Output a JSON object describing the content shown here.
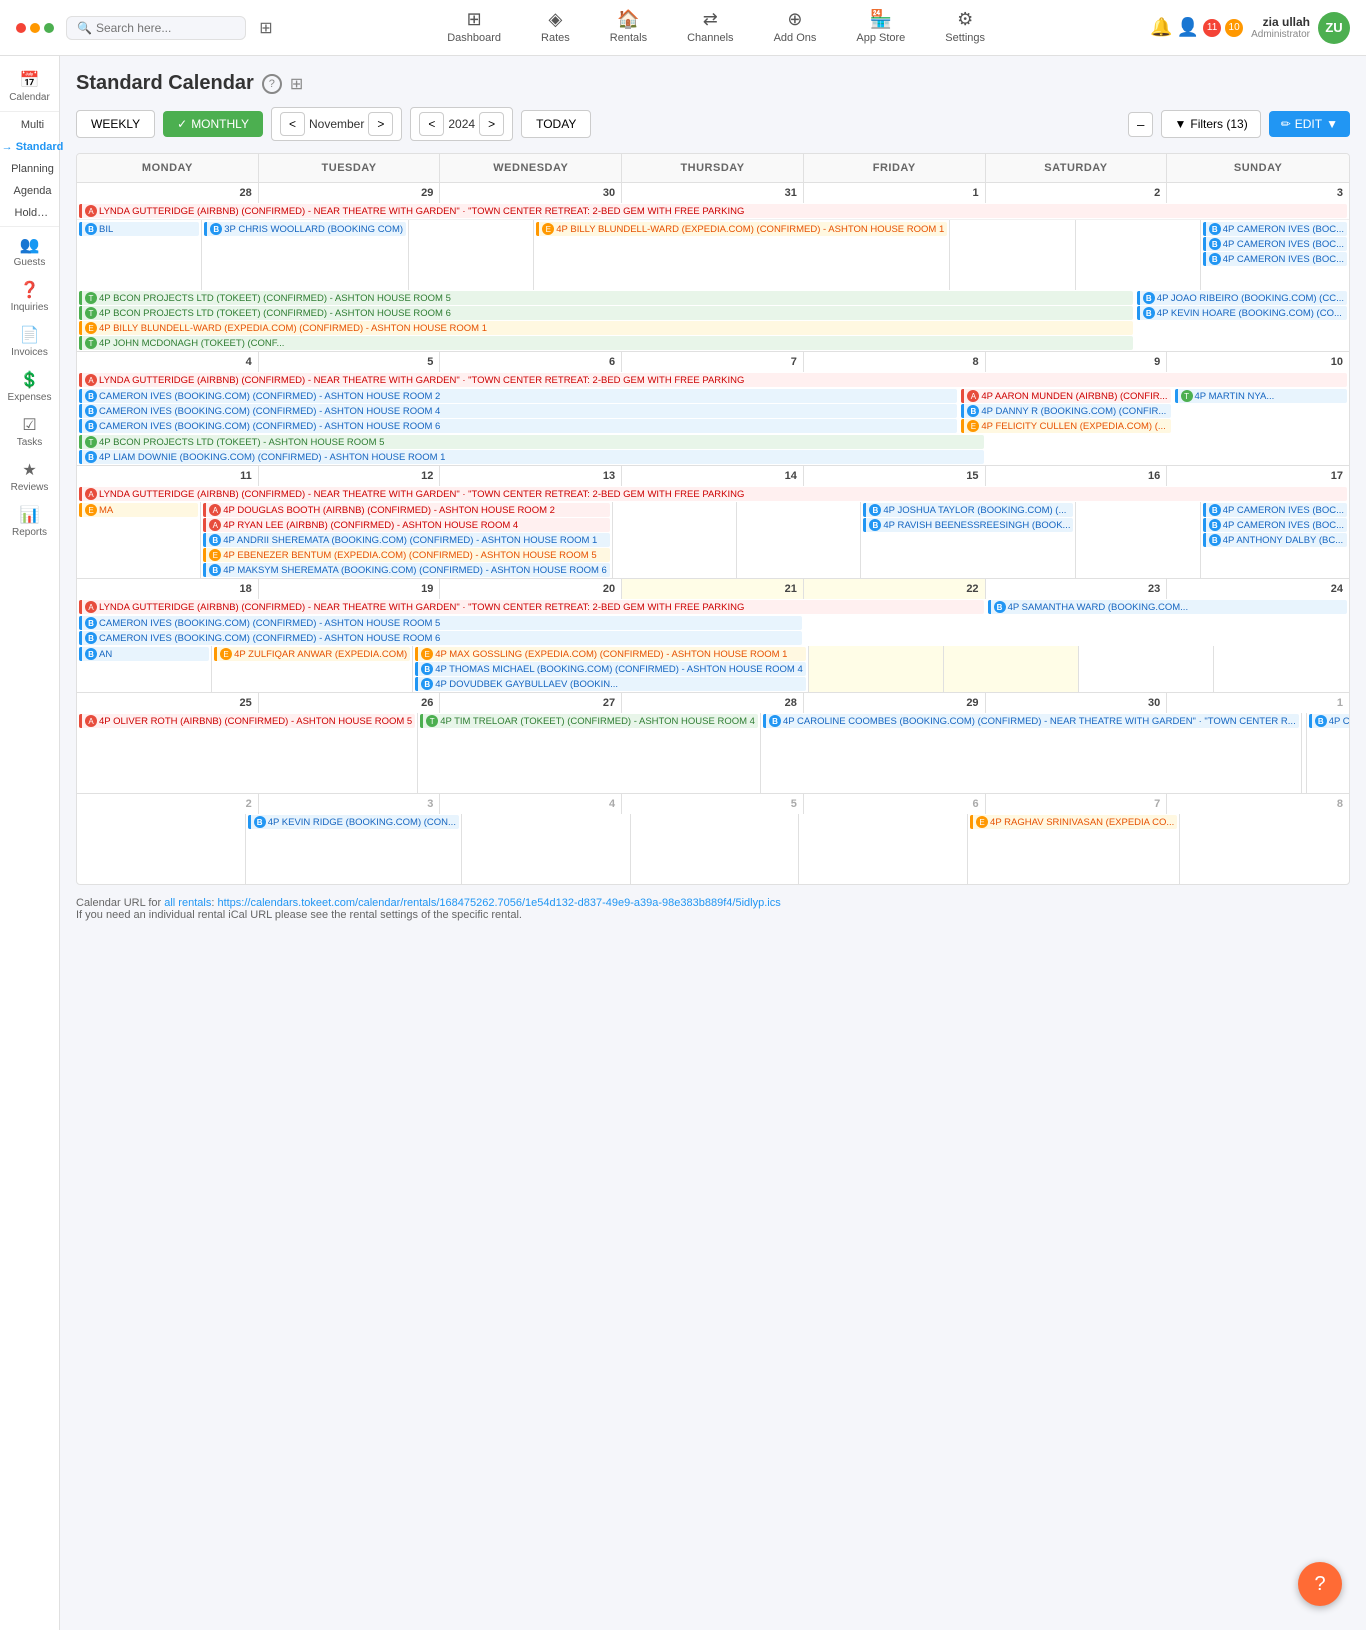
{
  "nav": {
    "search_placeholder": "Search here...",
    "items": [
      {
        "label": "Dashboard",
        "icon": "⊞"
      },
      {
        "label": "Rates",
        "icon": "◈"
      },
      {
        "label": "Rentals",
        "icon": "🏠"
      },
      {
        "label": "Channels",
        "icon": "⇄"
      },
      {
        "label": "Add Ons",
        "icon": "+"
      },
      {
        "label": "App Store",
        "icon": "🗑"
      },
      {
        "label": "Settings",
        "icon": "⚙"
      }
    ],
    "notifications_red": "11",
    "notifications_orange": "10",
    "user_name": "zia ullah",
    "user_role": "Administrator",
    "user_initials": "ZU"
  },
  "sidebar": {
    "items": [
      {
        "label": "Calendar",
        "icon": "📅"
      },
      {
        "label": "Multi",
        "sub": true
      },
      {
        "label": "Standard",
        "sub": true,
        "active": true
      },
      {
        "label": "Planning",
        "sub": true
      },
      {
        "label": "Agenda",
        "sub": true
      },
      {
        "label": "Hold Eve...",
        "sub": true
      },
      {
        "label": "Guests",
        "icon": "👥"
      },
      {
        "label": "Inquiries",
        "icon": "?"
      },
      {
        "label": "Invoices",
        "icon": "📄"
      },
      {
        "label": "Expenses",
        "icon": "💲"
      },
      {
        "label": "Tasks",
        "icon": "☑"
      },
      {
        "label": "Reviews",
        "icon": "★"
      },
      {
        "label": "Reports",
        "icon": "📊"
      }
    ]
  },
  "calendar": {
    "title": "Standard Calendar",
    "view_weekly": "WEEKLY",
    "view_monthly": "✓  MONTHLY",
    "month": "November",
    "year": "2024",
    "btn_today": "TODAY",
    "btn_filters": "Filters (13)",
    "btn_edit": "EDIT",
    "day_headers": [
      "MONDAY",
      "TUESDAY",
      "WEDNESDAY",
      "THURSDAY",
      "FRIDAY",
      "SATURDAY",
      "SUNDAY"
    ],
    "footer_url": "https://calendars.tokeet.com/calendar/rentals/168475262.7056/1e54d132-d837-49e9-a39a-98e383b889f4/5idlyp.ics",
    "footer_note": "If you need an individual rental iCal URL please see the rental settings of the specific rental."
  }
}
